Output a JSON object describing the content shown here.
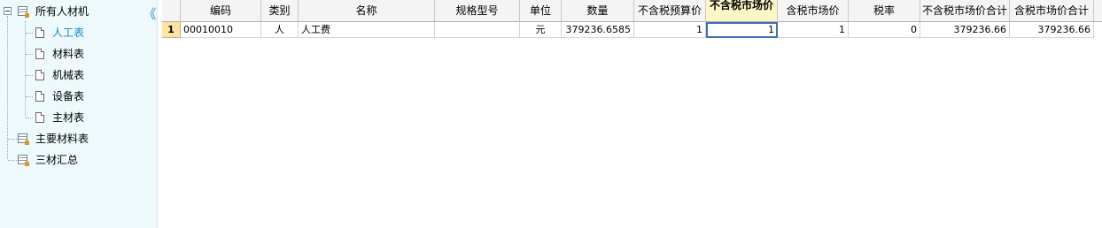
{
  "tree": {
    "collapse_icon": "double-chevron-left-icon",
    "root": {
      "label": "所有人材机"
    },
    "children": [
      {
        "label": "人工表",
        "selected": true
      },
      {
        "label": "材料表"
      },
      {
        "label": "机械表"
      },
      {
        "label": "设备表"
      },
      {
        "label": "主材表"
      }
    ],
    "siblings": [
      {
        "label": "主要材料表"
      },
      {
        "label": "三材汇总"
      }
    ],
    "selected_color": "#1687c9"
  },
  "grid": {
    "columns": [
      {
        "key": "code",
        "label": "编码"
      },
      {
        "key": "category",
        "label": "类别"
      },
      {
        "key": "name",
        "label": "名称"
      },
      {
        "key": "spec",
        "label": "规格型号"
      },
      {
        "key": "unit",
        "label": "单位"
      },
      {
        "key": "qty",
        "label": "数量"
      },
      {
        "key": "budget",
        "label": "不含税预算价"
      },
      {
        "key": "market_ex",
        "label": "不含税市场价"
      },
      {
        "key": "market_inc",
        "label": "含税市场价"
      },
      {
        "key": "tax",
        "label": "税率"
      },
      {
        "key": "total_ex",
        "label": "不含税市场价合计"
      },
      {
        "key": "total_inc",
        "label": "含税市场价合计"
      }
    ],
    "rows": [
      {
        "num": "1",
        "cells": [
          "00010010",
          "人",
          "人工费",
          "",
          "元",
          "379236.6585",
          "1",
          "1",
          "1",
          "0",
          "379236.66",
          "379236.66"
        ]
      }
    ],
    "active_column": "不含税市场价",
    "header_bg": "#f4f4f4",
    "row_header_bg": "#ffe3a3"
  }
}
